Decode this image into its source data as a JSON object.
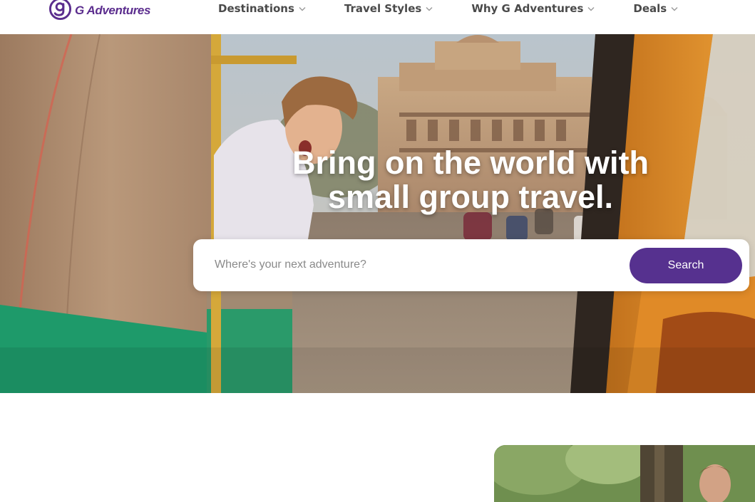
{
  "header": {
    "logo": {
      "mark": "g",
      "text": "G Adventures",
      "brand_color": "#5b2d8e"
    },
    "nav": [
      {
        "label": "Destinations",
        "icon": "chevron-down-icon"
      },
      {
        "label": "Travel Styles",
        "icon": "chevron-down-icon"
      },
      {
        "label": "Why G Adventures",
        "icon": "chevron-down-icon"
      },
      {
        "label": "Deals",
        "icon": "chevron-down-icon"
      }
    ]
  },
  "hero": {
    "headline_line1": "Bring on the world with",
    "headline_line2": "small group travel.",
    "image": "traveler leaning out of a tuk-tuk in front of a palace",
    "search": {
      "placeholder": "Where's your next adventure?",
      "value": "",
      "button_label": "Search",
      "button_color": "#56318f"
    }
  },
  "below": {
    "card_image": "traveler in a green forest"
  }
}
